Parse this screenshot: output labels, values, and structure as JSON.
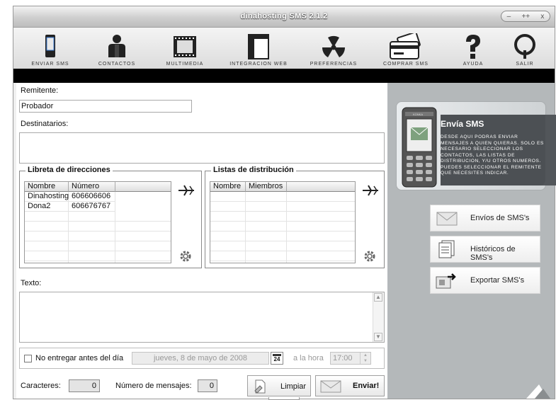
{
  "window": {
    "title": "dinahosting SMS 2.1.2",
    "controls": [
      "–",
      "++",
      "x"
    ]
  },
  "toolbar": {
    "items": [
      {
        "label": "ENVIAR SMS",
        "icon": "phone-icon"
      },
      {
        "label": "CONTACTOS",
        "icon": "person-icon"
      },
      {
        "label": "MULTIMEDIA",
        "icon": "film-icon"
      },
      {
        "label": "INTEGRACION WEB",
        "icon": "web-page-icon"
      },
      {
        "label": "PREFERENCIAS",
        "icon": "radiation-icon"
      },
      {
        "label": "COMPRAR SMS",
        "icon": "credit-card-icon"
      },
      {
        "label": "AYUDA",
        "icon": "question-icon"
      },
      {
        "label": "SALIR",
        "icon": "exit-icon"
      }
    ]
  },
  "form": {
    "remitente_label": "Remitente:",
    "remitente_value": "Probador",
    "destinatarios_label": "Destinatarios:",
    "texto_label": "Texto:"
  },
  "libreta": {
    "title": "Libreta de direcciones",
    "headers": [
      "Nombre",
      "Número"
    ],
    "rows": [
      {
        "nombre": "Dinahosting",
        "numero": "606606606"
      },
      {
        "nombre": "Dona2",
        "numero": "606676767"
      }
    ]
  },
  "listas": {
    "title": "Listas de distribución",
    "headers": [
      "Nombre",
      "Miembros"
    ]
  },
  "schedule": {
    "checkbox_label": "No entregar antes del día",
    "date_value": "jueves, 8 de mayo de 2008",
    "calendar_day": "24",
    "hour_label": "a la hora",
    "time_value": "17:00"
  },
  "footer": {
    "caracteres_label": "Caracteres:",
    "caracteres_value": "0",
    "mensajes_label": "Número de mensajes:",
    "mensajes_value": "0",
    "limpiar_label": "Limpiar",
    "enviar_label": "Enviar!"
  },
  "promo": {
    "title": "Envía SMS",
    "brand": "KONKA",
    "body": "DESDE AQUI PODRAS ENVIAR MENSAJES A QUIEN QUIERAS. SOLO ES NECESARIO SELECCIONAR LOS CONTACTOS, LAS LISTAS DE DISTRIBUCION, Y/U OTROS NUMEROS. PUEDES SELECCIONAR EL REMITENTE QUE NECESITES INDICAR."
  },
  "side_buttons": [
    {
      "label": "Envíos de SMS's",
      "icon": "envelope-icon"
    },
    {
      "label": "Históricos de SMS's",
      "icon": "documents-icon"
    },
    {
      "label": "Exportar SMS's",
      "icon": "export-icon"
    }
  ]
}
